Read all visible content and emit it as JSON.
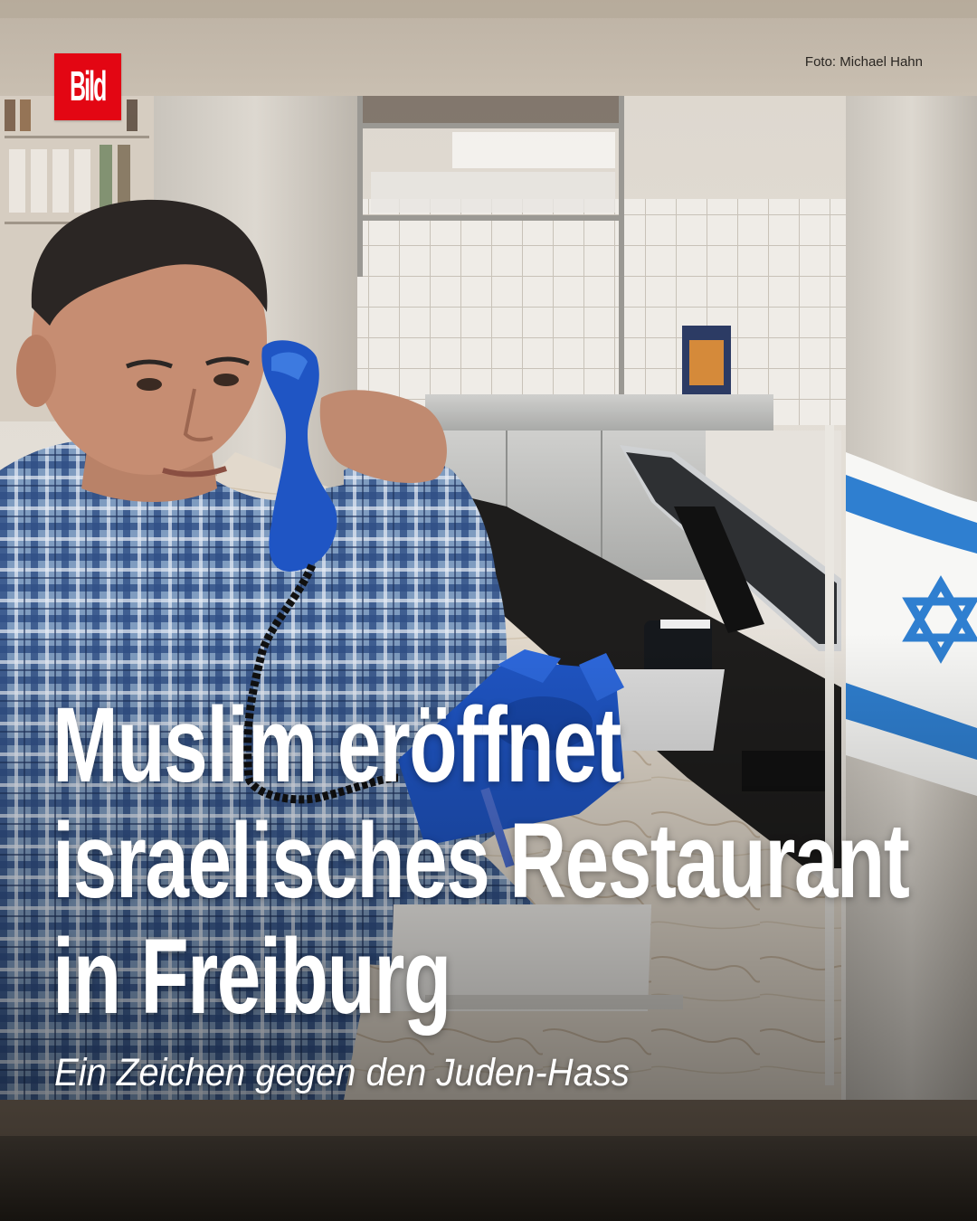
{
  "brand": {
    "logo_text": "Bild",
    "logo_color": "#e30613"
  },
  "photo_credit": "Foto: Michael Hahn",
  "headline": {
    "lines": [
      "Muslim eröffnet",
      "israelisches Restaurant",
      "in Freiburg"
    ]
  },
  "subheadline": "Ein Zeichen gegen den Juden-Hass",
  "colors": {
    "text": "#ffffff",
    "flag_blue": "#2f7fd0",
    "phone_blue": "#1f55c4"
  },
  "icons": [
    "bild-logo",
    "israel-flag",
    "blue-telephone"
  ]
}
